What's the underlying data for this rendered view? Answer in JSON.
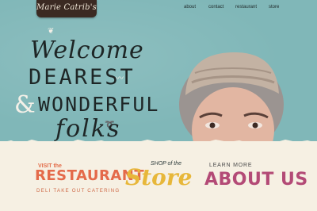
{
  "logo": {
    "text": "Marie Catrib's"
  },
  "nav": {
    "items": [
      "about",
      "contact",
      "restaurant",
      "store"
    ]
  },
  "hero": {
    "line1": "Welcome",
    "line2": "DEAREST",
    "ampersand": "&",
    "line3": "WONDERFUL",
    "line4": "folks"
  },
  "ctas": {
    "restaurant": {
      "label": "VISIT the",
      "title": "RESTAURANT",
      "sub": "DELI  TAKE OUT  CATERING"
    },
    "store": {
      "label": "SHOP of the",
      "title": "Store"
    },
    "about": {
      "label": "LEARN MORE",
      "title": "ABOUT US"
    }
  },
  "colors": {
    "teal": "#80b7b8",
    "cream": "#f6f0e3",
    "orange": "#e46a4a",
    "gold": "#e7b73a",
    "magenta": "#b34a76"
  }
}
